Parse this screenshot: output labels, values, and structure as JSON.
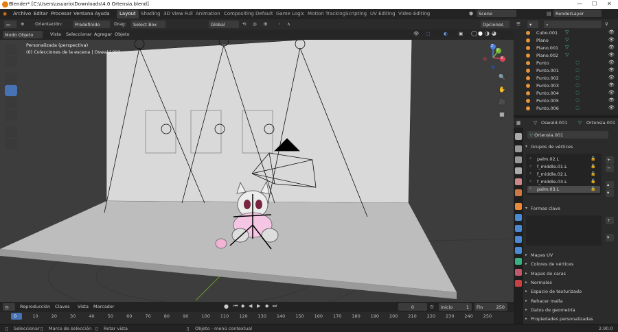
{
  "window": {
    "title": "Blender* [C:\\Users\\usuario\\Downloads\\4.0 Ortensia.blend]"
  },
  "menu": [
    "Archivo",
    "Editar",
    "Procesar",
    "Ventana",
    "Ayuda"
  ],
  "workspaces": [
    "Layout",
    "Shading",
    "3D View Full",
    "Animation",
    "Compositing",
    "Default",
    "Game Logic",
    "Motion Tracking",
    "Scripting",
    "UV Editing",
    "Video Editing"
  ],
  "scene": {
    "name": "Scene",
    "render_layer": "RenderLayer"
  },
  "viewport_header": {
    "orientation_label": "Orientación:",
    "orientation_value": "Predefinido",
    "drag_label": "Drag:",
    "drag_value": "Select Box",
    "transform_value": "Global",
    "options": "Opciones"
  },
  "viewport_menu": {
    "mode": "Modo Objeto",
    "items": [
      "Vista",
      "Seleccionar",
      "Agregar",
      "Objeto"
    ]
  },
  "viewport_info": {
    "line1": "Personalizada (perspectiva)",
    "line2": "(0) Colecciones de la escena | Oswald.001"
  },
  "gizmo": {
    "x": "X",
    "y": "Y",
    "z": "Z"
  },
  "outliner": [
    {
      "name": "Cubo.001"
    },
    {
      "name": "Plano"
    },
    {
      "name": "Plano.001"
    },
    {
      "name": "Plano.002"
    },
    {
      "name": "Punto"
    },
    {
      "name": "Punto.001"
    },
    {
      "name": "Punto.002"
    },
    {
      "name": "Punto.003"
    },
    {
      "name": "Punto.004"
    },
    {
      "name": "Punto.005"
    },
    {
      "name": "Punto.006"
    }
  ],
  "properties": {
    "object": "Oswald.001",
    "data": "Ortensia.001",
    "mesh_name": "Ortensia.001",
    "vertex_groups_title": "Grupos de vértices",
    "vertex_groups": [
      "palm.02.L",
      "f_middle.01.L",
      "f_middle.02.L",
      "f_middle.03.L",
      "palm.03.L"
    ],
    "shape_keys_title": "Formas clave",
    "collapsed_sections": [
      "Mapas UV",
      "Colores de vértices",
      "Mapas de caras",
      "Normales",
      "Espacio de texturizado",
      "Rehacer malla",
      "Datos de geometría",
      "Propiedades personalizadas"
    ]
  },
  "timeline": {
    "menu": [
      "Reproducción",
      "Claves",
      "Vista",
      "Marcador"
    ],
    "current_frame": "0",
    "start_label": "Inicio",
    "start": "1",
    "end_label": "Fin",
    "end": "250",
    "ticks": [
      "0",
      "10",
      "20",
      "30",
      "40",
      "50",
      "60",
      "70",
      "80",
      "90",
      "100",
      "110",
      "120",
      "130",
      "140",
      "150",
      "160",
      "170",
      "180",
      "190",
      "200",
      "210",
      "220",
      "230",
      "240",
      "250"
    ]
  },
  "status": {
    "select": "Seleccionar",
    "box": "Marco de selección",
    "rotate": "Rotar vista",
    "context": "Objeto - menú contextual",
    "version": "2.90.0"
  }
}
